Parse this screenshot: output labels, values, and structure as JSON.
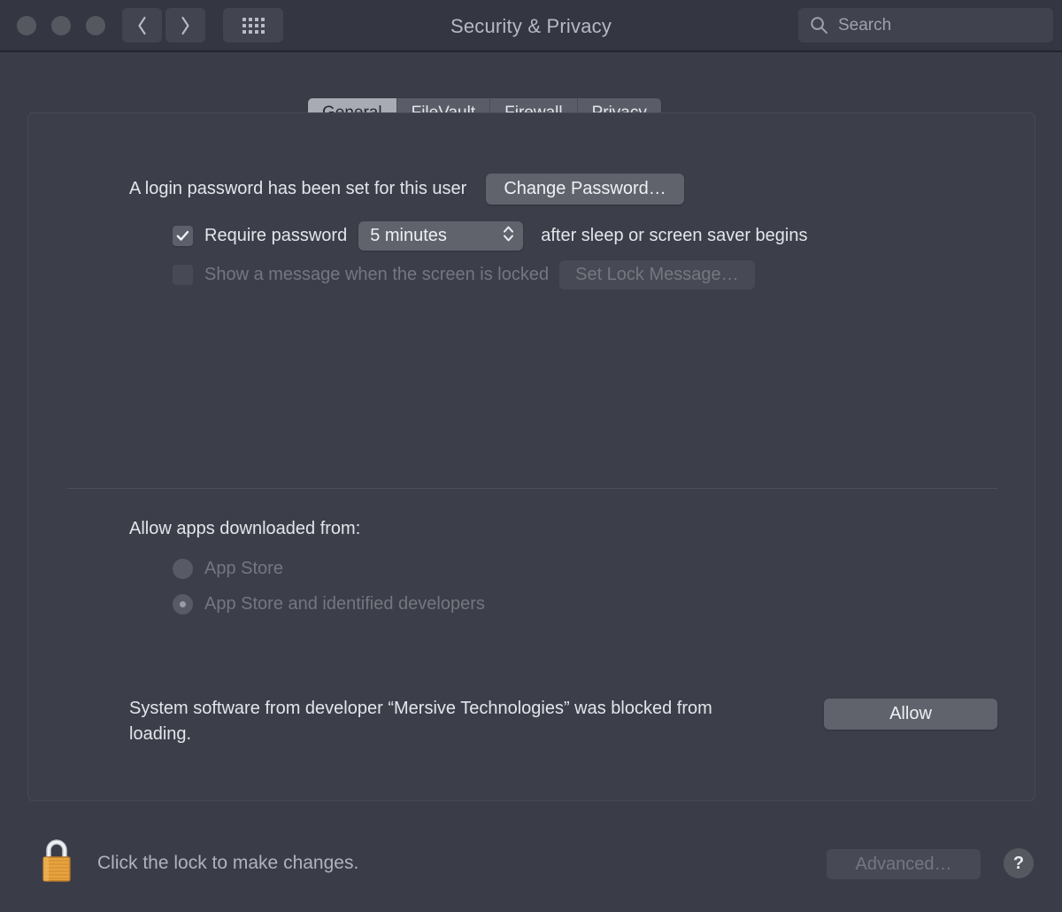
{
  "window": {
    "title": "Security & Privacy",
    "traffic_lights": [
      "close-button",
      "minimize-button",
      "zoom-button"
    ],
    "nav": {
      "back_icon": "chevron-left-icon",
      "forward_icon": "chevron-right-icon",
      "grid_icon": "grid-view-icon"
    },
    "search": {
      "placeholder": "Search",
      "value": "",
      "icon": "search-icon"
    }
  },
  "tabs": [
    {
      "label": "General",
      "active": true
    },
    {
      "label": "FileVault",
      "active": false
    },
    {
      "label": "Firewall",
      "active": false
    },
    {
      "label": "Privacy",
      "active": false
    }
  ],
  "general": {
    "password_status": "A login password has been set for this user",
    "change_password_button": "Change Password…",
    "require_password": {
      "label": "Require password",
      "checked": true,
      "delay_value": "5 minutes",
      "suffix": "after sleep or screen saver begins"
    },
    "lock_message": {
      "label": "Show a message when the screen is locked",
      "checked": false,
      "button": "Set Lock Message…",
      "disabled": true
    },
    "allow_apps": {
      "heading": "Allow apps downloaded from:",
      "options": [
        {
          "label": "App Store",
          "selected": false
        },
        {
          "label": "App Store and identified developers",
          "selected": true
        }
      ],
      "disabled": true
    },
    "blocked_notice": {
      "text": "System software from developer “Mersive Technologies” was blocked from loading.",
      "button": "Allow"
    }
  },
  "footer": {
    "lock_icon": "lock-closed-icon",
    "lock_text": "Click the lock to make changes.",
    "advanced_button": "Advanced…",
    "advanced_disabled": true,
    "help_button": "?"
  },
  "colors": {
    "window_bg": "#3a3d48",
    "titlebar_bg": "#343742",
    "panel_bg": "#3c3f4a",
    "button_bg": "#60636c",
    "active_tab_bg": "#a8abb3",
    "text": "#e3e5ea",
    "dim_text": "#74777f",
    "lock_body": "#e8a33d"
  }
}
